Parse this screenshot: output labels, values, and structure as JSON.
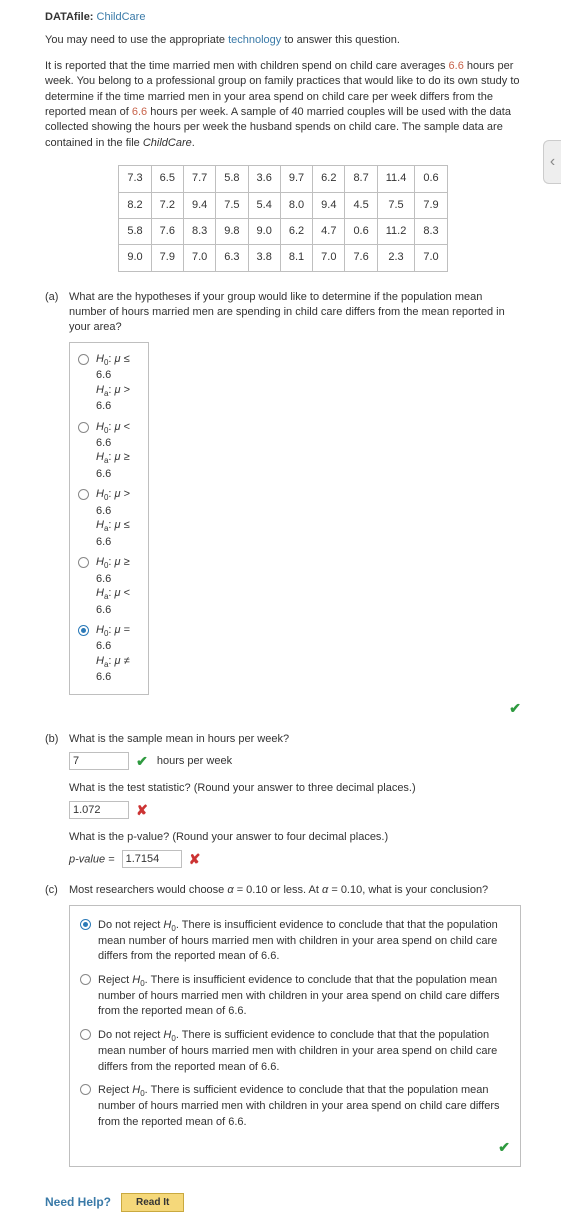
{
  "datafile": {
    "label": "DATAfile:",
    "link": "ChildCare"
  },
  "tech_note": {
    "pre": "You may need to use the appropriate ",
    "link": "technology",
    "post": " to answer this question."
  },
  "problem": {
    "t1": "It is reported that the time married men with children spend on child care averages ",
    "n1": "6.6",
    "t2": " hours per week. You belong to a professional group on family practices that would like to do its own study to determine if the time married men in your area spend on child care per week differs from the reported mean of ",
    "n2": "6.6",
    "t3": " hours per week. A sample of 40 married couples will be used with the data collected showing the hours per week the husband spends on child care. The sample data are contained in the file ",
    "file": "ChildCare",
    "t4": "."
  },
  "data_rows": [
    [
      "7.3",
      "6.5",
      "7.7",
      "5.8",
      "3.6",
      "9.7",
      "6.2",
      "8.7",
      "11.4",
      "0.6"
    ],
    [
      "8.2",
      "7.2",
      "9.4",
      "7.5",
      "5.4",
      "8.0",
      "9.4",
      "4.5",
      "7.5",
      "7.9"
    ],
    [
      "5.8",
      "7.6",
      "8.3",
      "9.8",
      "9.0",
      "6.2",
      "4.7",
      "0.6",
      "11.2",
      "8.3"
    ],
    [
      "9.0",
      "7.9",
      "7.0",
      "6.3",
      "3.8",
      "8.1",
      "7.0",
      "7.6",
      "2.3",
      "7.0"
    ]
  ],
  "a": {
    "label": "(a)",
    "q": "What are the hypotheses if your group would like to determine if the population mean number of hours married men are spending in child care differs from the mean reported in your area?",
    "options": [
      {
        "h0": "H₀: μ ≤ 6.6",
        "ha": "Hₐ: μ > 6.6",
        "selected": false
      },
      {
        "h0": "H₀: μ < 6.6",
        "ha": "Hₐ: μ ≥ 6.6",
        "selected": false
      },
      {
        "h0": "H₀: μ > 6.6",
        "ha": "Hₐ: μ ≤ 6.6",
        "selected": false
      },
      {
        "h0": "H₀: μ ≥ 6.6",
        "ha": "Hₐ: μ < 6.6",
        "selected": false
      },
      {
        "h0": "H₀: μ = 6.6",
        "ha": "Hₐ: μ ≠ 6.6",
        "selected": true
      }
    ]
  },
  "b": {
    "label": "(b)",
    "q1": "What is the sample mean in hours per week?",
    "ans1": "7",
    "unit1": "hours per week",
    "mark1": "check",
    "q2": "What is the test statistic? (Round your answer to three decimal places.)",
    "ans2": "1.072",
    "mark2": "cross",
    "q3": "What is the p-value? (Round your answer to four decimal places.)",
    "p_label": "p-value =",
    "ans3": "1.7154",
    "mark3": "cross"
  },
  "c": {
    "label": "(c)",
    "q": "Most researchers would choose α = 0.10 or less. At α = 0.10, what is your conclusion?",
    "options": [
      {
        "selected": true,
        "pre": "Do not reject ",
        "h": "H₀",
        "post": ". There is insufficient evidence to conclude that that the population mean number of hours married men with children in your area spend on child care differs from the reported mean of 6.6."
      },
      {
        "selected": false,
        "pre": "Reject ",
        "h": "H₀",
        "post": ". There is insufficient evidence to conclude that that the population mean number of hours married men with children in your area spend on child care differs from the reported mean of 6.6."
      },
      {
        "selected": false,
        "pre": "Do not reject ",
        "h": "H₀",
        "post": ". There is sufficient evidence to conclude that that the population mean number of hours married men with children in your area spend on child care differs from the reported mean of 6.6."
      },
      {
        "selected": false,
        "pre": "Reject ",
        "h": "H₀",
        "post": ". There is sufficient evidence to conclude that that the population mean number of hours married men with children in your area spend on child care differs from the reported mean of 6.6."
      }
    ],
    "mark": "check"
  },
  "need_help": {
    "label": "Need Help?",
    "button": "Read It"
  },
  "side_chevron": "‹"
}
